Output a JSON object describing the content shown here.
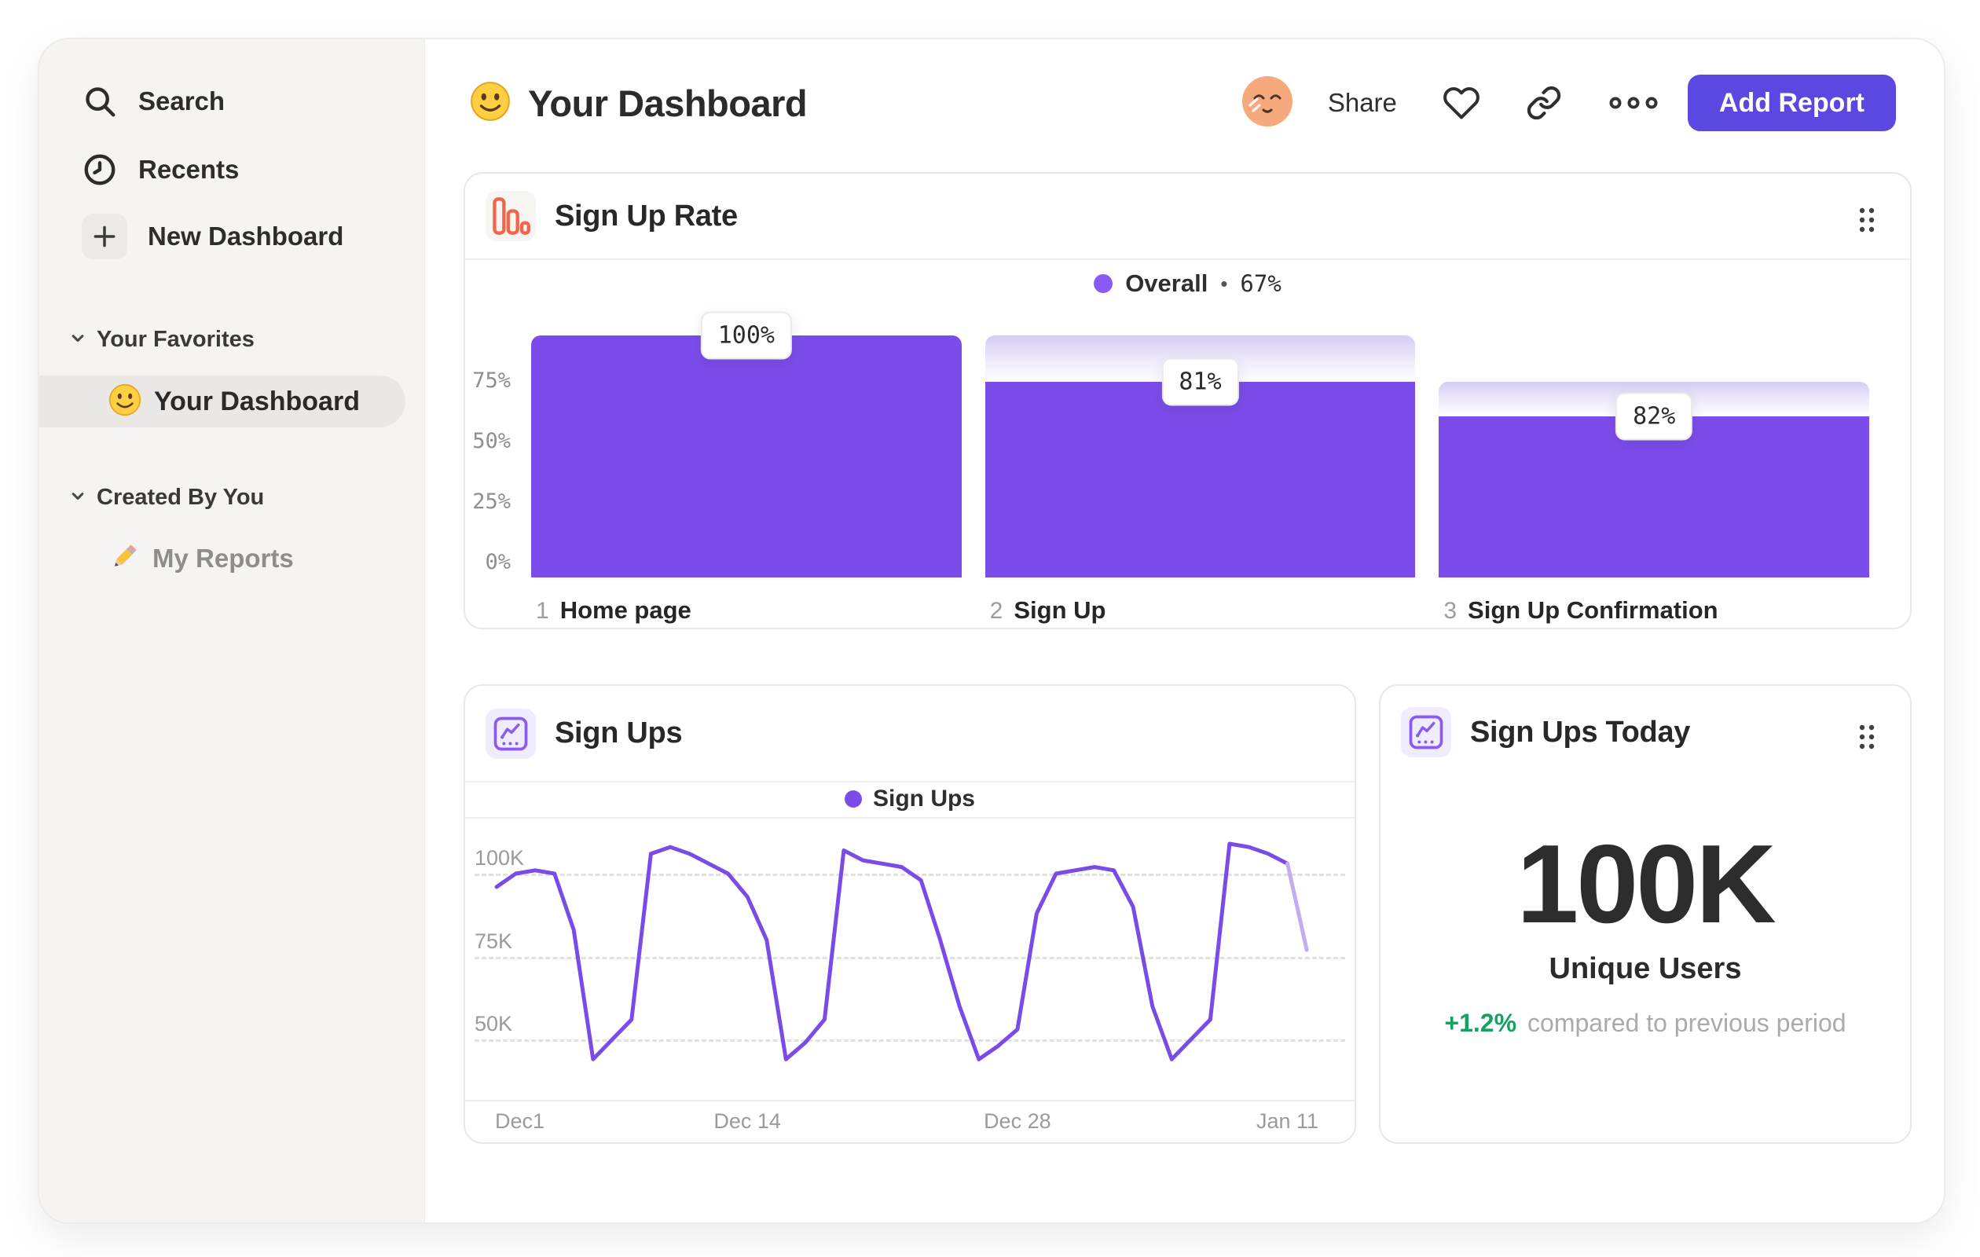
{
  "sidebar": {
    "search": "Search",
    "recents": "Recents",
    "new_dashboard": "New Dashboard",
    "your_favorites": "Your Favorites",
    "your_dashboard": "Your Dashboard",
    "created_by_you": "Created By You",
    "my_reports": "My Reports"
  },
  "header": {
    "title": "Your Dashboard",
    "share": "Share",
    "add_report": "Add Report"
  },
  "cards": {
    "funnel": {
      "title": "Sign Up Rate",
      "legend_name": "Overall",
      "legend_sep": "•",
      "legend_value": "67%"
    },
    "line": {
      "title": "Sign Ups",
      "legend": "Sign Ups"
    },
    "today": {
      "title": "Sign Ups Today",
      "value": "100K",
      "unit_label": "Unique Users",
      "change": "+1.2%",
      "change_text": "compared to previous period"
    }
  },
  "colors": {
    "accent_purple": "#7C4CEA",
    "line_purple": "#7B4BE8",
    "legend_dot_purple": "#8A5BF2",
    "button_purple": "#5A48E0",
    "positive_green": "#14A35F",
    "funnel_icon_orange": "#F2654C"
  },
  "chart_data": [
    {
      "type": "bar",
      "variant": "funnel",
      "title": "Sign Up Rate",
      "legend": {
        "name": "Overall",
        "value_label": "67%"
      },
      "categories": [
        "Home page",
        "Sign Up",
        "Sign Up Confirmation"
      ],
      "step_indices": [
        "1",
        "2",
        "3"
      ],
      "values": [
        100,
        81,
        82
      ],
      "value_labels": [
        "100%",
        "81%",
        "82%"
      ],
      "cumulative_pct": [
        100,
        81,
        66.4
      ],
      "ylabel_ticks": [
        "75%",
        "50%",
        "25%",
        "0%"
      ],
      "ylim": [
        0,
        100
      ],
      "bar_color": "#7C4CEA",
      "legend_position": "top-center"
    },
    {
      "type": "line",
      "title": "Sign Ups",
      "xlabel": "",
      "ylabel": "",
      "x_tick_labels": [
        "Dec1",
        "Dec 14",
        "Dec 28",
        "Jan 11"
      ],
      "x_tick_days": [
        0,
        13,
        27,
        41
      ],
      "y_ticks": [
        "100K",
        "75K",
        "50K"
      ],
      "y_tick_values": [
        100000,
        75000,
        50000
      ],
      "ylim_k": [
        32,
        114
      ],
      "grid": "dashed-horizontal",
      "legend_position": "top-center",
      "series": [
        {
          "name": "Sign Ups",
          "color": "#7B4BE8",
          "faded_color": "#C2ADF1",
          "faded_from_index": 41,
          "values_k": [
            96,
            100,
            101,
            100,
            83,
            44,
            50,
            56,
            106,
            108,
            106,
            103,
            100,
            93,
            80,
            44,
            49,
            56,
            107,
            104,
            103,
            102,
            98,
            80,
            60,
            44,
            48,
            53,
            88,
            100,
            101,
            102,
            101,
            90,
            60,
            44,
            50,
            56,
            109,
            108,
            106,
            103,
            77
          ]
        }
      ]
    }
  ]
}
